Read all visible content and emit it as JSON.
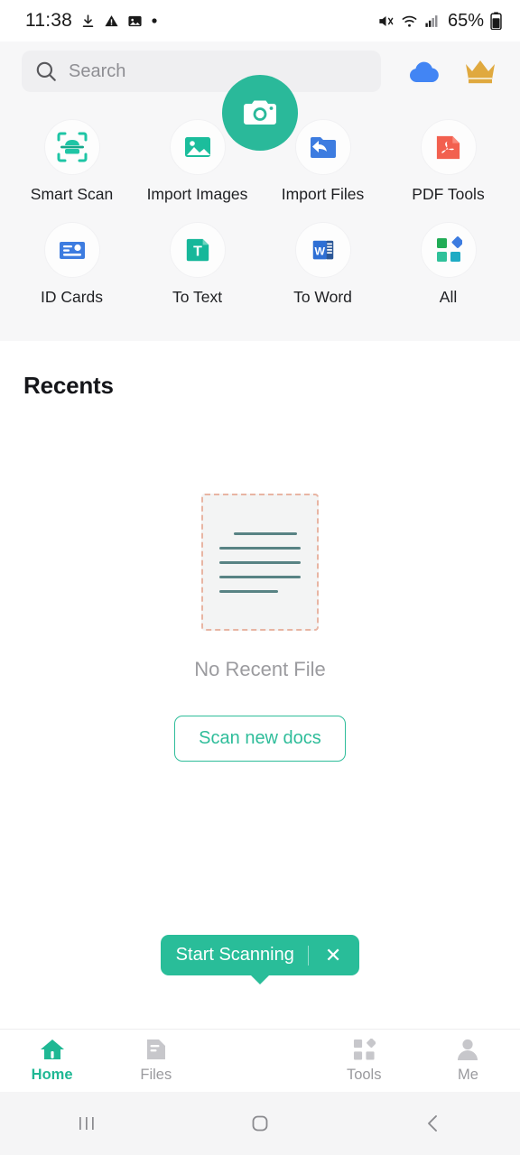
{
  "status_bar": {
    "time": "11:38",
    "battery_percent": "65%",
    "icons": [
      "download-icon",
      "warning-icon",
      "image-icon",
      "dot-icon",
      "mute-icon",
      "wifi-icon",
      "signal-icon",
      "battery-icon"
    ]
  },
  "search": {
    "placeholder": "Search",
    "icon": "search-icon"
  },
  "header": {
    "cloud_icon": "cloud-icon",
    "crown_icon": "crown-icon",
    "cloud_color": "#4285f4",
    "crown_color": "#e0a93f"
  },
  "tools": [
    {
      "label": "Smart Scan",
      "icon": "smart-scan-icon"
    },
    {
      "label": "Import Images",
      "icon": "import-images-icon"
    },
    {
      "label": "Import Files",
      "icon": "import-files-icon"
    },
    {
      "label": "PDF Tools",
      "icon": "pdf-tools-icon"
    },
    {
      "label": "ID Cards",
      "icon": "id-cards-icon"
    },
    {
      "label": "To Text",
      "icon": "to-text-icon"
    },
    {
      "label": "To Word",
      "icon": "to-word-icon"
    },
    {
      "label": "All",
      "icon": "all-tools-icon"
    }
  ],
  "recents": {
    "title": "Recents",
    "empty_text": "No Recent File",
    "scan_button": "Scan new docs"
  },
  "tooltip": {
    "text": "Start Scanning",
    "close": "✕"
  },
  "bottom_nav": [
    {
      "label": "Home",
      "icon": "home-icon",
      "active": true
    },
    {
      "label": "Files",
      "icon": "files-icon",
      "active": false
    },
    {
      "label": "Tools",
      "icon": "tools-icon",
      "active": false
    },
    {
      "label": "Me",
      "icon": "person-icon",
      "active": false
    }
  ],
  "fab": {
    "icon": "camera-icon"
  },
  "android_nav": [
    {
      "icon": "recent-apps-icon"
    },
    {
      "icon": "home-square-icon"
    },
    {
      "icon": "back-icon"
    }
  ],
  "colors": {
    "accent": "#2ab99a",
    "tooltip_bg": "#29bd99",
    "page_bg": "#f7f7f8"
  }
}
